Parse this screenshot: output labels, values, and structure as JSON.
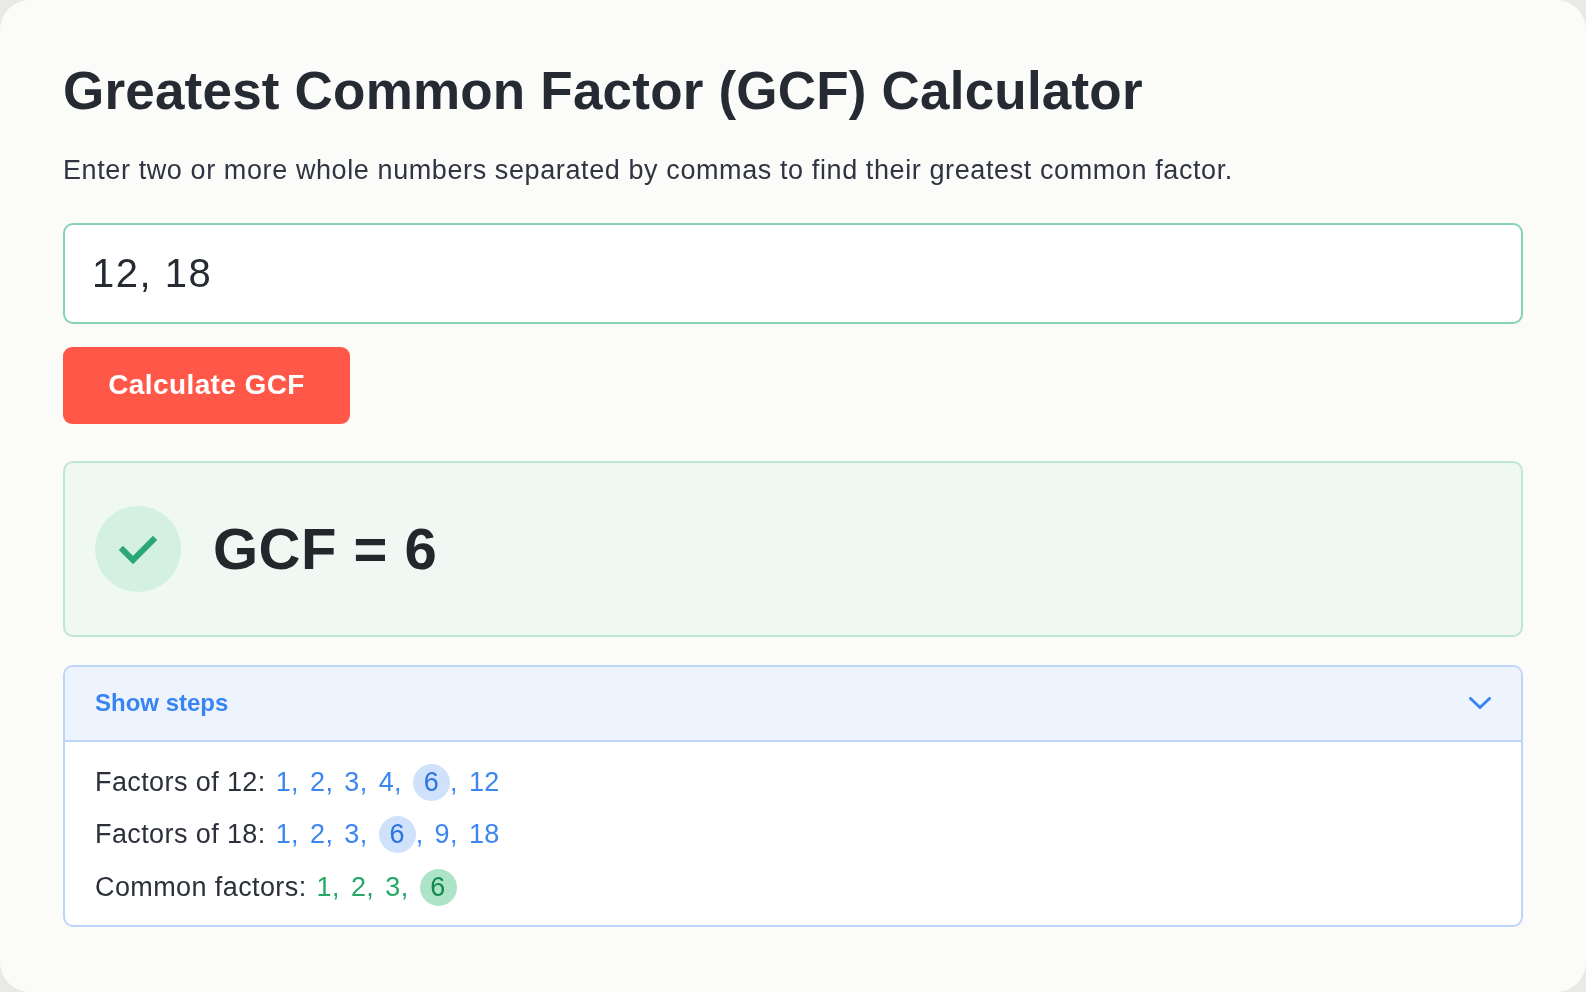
{
  "title": "Greatest Common Factor (GCF) Calculator",
  "subtitle": "Enter two or more whole numbers separated by commas to find their greatest common factor.",
  "input": {
    "value": "12, 18"
  },
  "button": {
    "label": "Calculate GCF"
  },
  "result": {
    "success": true,
    "text": "GCF = 6"
  },
  "steps": {
    "title": "Show steps",
    "expanded": true,
    "separator": ",",
    "rows": [
      {
        "kind": "factors",
        "label": "Factors of 12:",
        "factors": [
          {
            "value": "1",
            "highlighted": false
          },
          {
            "value": "2",
            "highlighted": false
          },
          {
            "value": "3",
            "highlighted": false
          },
          {
            "value": "4",
            "highlighted": false
          },
          {
            "value": "6",
            "highlighted": true
          },
          {
            "value": "12",
            "highlighted": false
          }
        ]
      },
      {
        "kind": "factors",
        "label": "Factors of 18:",
        "factors": [
          {
            "value": "1",
            "highlighted": false
          },
          {
            "value": "2",
            "highlighted": false
          },
          {
            "value": "3",
            "highlighted": false
          },
          {
            "value": "6",
            "highlighted": true
          },
          {
            "value": "9",
            "highlighted": false
          },
          {
            "value": "18",
            "highlighted": false
          }
        ]
      },
      {
        "kind": "common",
        "label": "Common factors:",
        "factors": [
          {
            "value": "1",
            "highlighted": false
          },
          {
            "value": "2",
            "highlighted": false
          },
          {
            "value": "3",
            "highlighted": false
          },
          {
            "value": "6",
            "highlighted": true
          }
        ]
      }
    ]
  }
}
